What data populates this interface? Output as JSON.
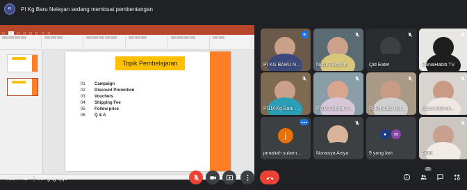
{
  "header": {
    "presenting_text": "PI Kg Baru Nelayan sedang membuat pembentangan",
    "logo_icon": "school-logo-icon"
  },
  "slide": {
    "title": "Topik Pembelajaran",
    "agenda": [
      {
        "num": "01",
        "text": "Campaign"
      },
      {
        "num": "02",
        "text": "Discount Promotion"
      },
      {
        "num": "03",
        "text": "Vouchers"
      },
      {
        "num": "04",
        "text": "Shipping Fee"
      },
      {
        "num": "05",
        "text": "Follow price"
      },
      {
        "num": "06",
        "text": "Q & A"
      }
    ],
    "accent_color": "#ff7f27",
    "title_color": "#ffc000"
  },
  "participants": [
    {
      "name": "PI KG BARU N...",
      "speaking": true
    },
    {
      "name": "Nurul Fadhilah",
      "muted": true
    },
    {
      "name": "Qid Eater",
      "muted": true
    },
    {
      "name": "RaniaHabib TV",
      "muted": true
    },
    {
      "name": "PI1M Kg Baru ...",
      "muted": true
    },
    {
      "name": "PI1M Sungai P...",
      "muted": true
    },
    {
      "name": "PI Kg Baru Nel...",
      "muted": true
    },
    {
      "name": "Nurul Aidil An...",
      "muted": true
    },
    {
      "name": "jamaliah sulaim...",
      "avatar_letter": "j",
      "avatar_color": "#e8710a"
    },
    {
      "name": "Noraisya Aisya",
      "muted": true
    },
    {
      "name": "9 yang lain",
      "avatar_letters": [
        "m"
      ],
      "avatar_color": "#8e44ad"
    },
    {
      "name": "Anda",
      "muted": true
    }
  ],
  "footer": {
    "time": "4:09 PTG",
    "separator": "|",
    "meeting_code": "vor-gtig-qqo",
    "participants_count": "21"
  },
  "colors": {
    "bg": "#202124",
    "tile_bg": "#3c4043",
    "red": "#ea4335",
    "blue": "#1a73e8"
  }
}
